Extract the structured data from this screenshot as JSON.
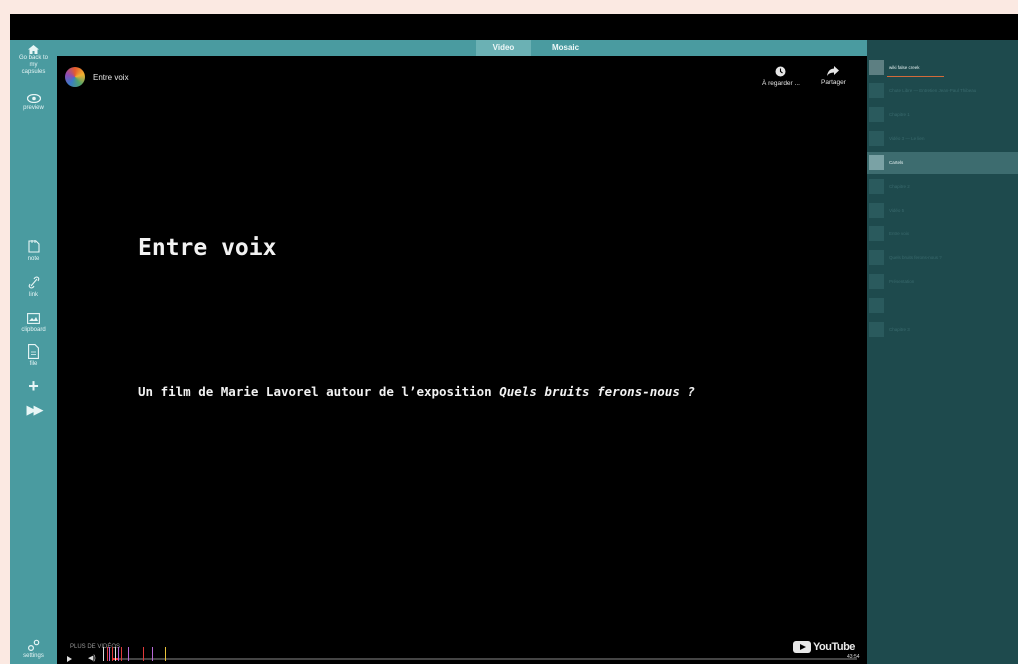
{
  "sidebar": {
    "home_label": "Go back to my capsules",
    "preview_label": "preview",
    "note_label": "note",
    "link_label": "link",
    "clipboard_label": "clipboard",
    "file_label": "file",
    "add_symbol": "+",
    "forward_symbol": "▶▶",
    "settings_label": "settings"
  },
  "tabs": [
    {
      "label": "Video",
      "active": true
    },
    {
      "label": "Mosaic",
      "active": false
    }
  ],
  "video": {
    "channel_title": "Entre voix",
    "watch_later_label": "À regarder ...",
    "share_label": "Partager",
    "title_card": "Entre voix",
    "subtitle_prefix": "Un film de Marie Lavorel autour de l’exposition ",
    "subtitle_italic": "Quels bruits ferons-nous ?",
    "more_videos_label": "PLUS DE VIDÉOS",
    "youtube_label": "YouTube",
    "duration": "43:54",
    "progress_percent": 1
  },
  "right_panel": {
    "items": [
      {
        "label": "wiki false creek",
        "state": "first"
      },
      {
        "label": "Chute Libre — Entretien Jean-Paul Thibeau",
        "state": "dim"
      },
      {
        "label": "Chapitre 1",
        "state": "dim"
      },
      {
        "label": "Vidéo 3 — Le lien",
        "state": "dim"
      },
      {
        "label": "Cartels",
        "state": "selected"
      },
      {
        "label": "Chapitre 2",
        "state": "dim"
      },
      {
        "label": "Vidéo 5",
        "state": "dim"
      },
      {
        "label": "Entre voix",
        "state": "dim"
      },
      {
        "label": "Quels bruits ferons-nous ?",
        "state": "dim"
      },
      {
        "label": "Présentation",
        "state": "dim"
      },
      {
        "label": "",
        "state": "dim"
      },
      {
        "label": "Chapitre 3",
        "state": "dim"
      }
    ]
  },
  "colors": {
    "teal": "#4a9ba0",
    "active_tab": "#6bb1b4",
    "panel": "#1e4a4d",
    "selected_item": "#3d6c6f",
    "underline": "#d26a3a"
  }
}
